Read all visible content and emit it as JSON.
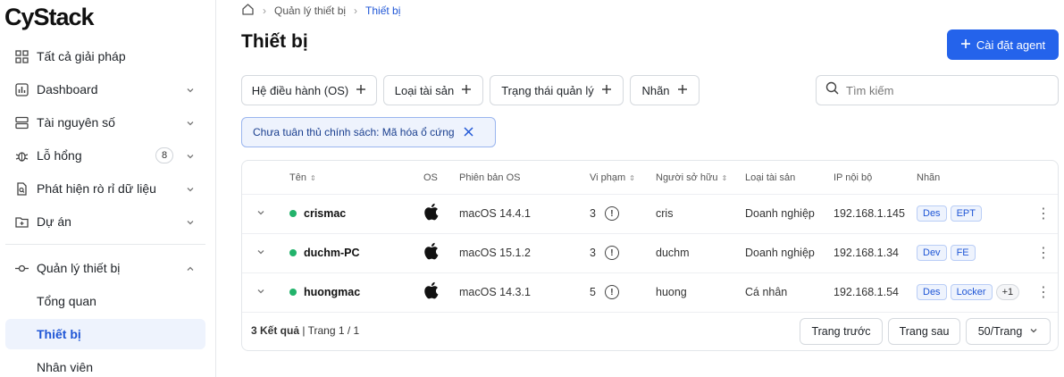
{
  "brand": {
    "logo_text": "CyStack"
  },
  "sidebar": {
    "items": [
      {
        "label": "Tất cả giải pháp",
        "icon": "grid-icon"
      },
      {
        "label": "Dashboard",
        "icon": "chart-icon"
      },
      {
        "label": "Tài nguyên số",
        "icon": "server-icon"
      },
      {
        "label": "Lỗ hổng",
        "icon": "bug-icon",
        "badge": "8"
      },
      {
        "label": "Phát hiện rò rỉ dữ liệu",
        "icon": "document-search-icon"
      },
      {
        "label": "Dự án",
        "icon": "folder-icon"
      },
      {
        "label": "Quản lý thiết bị",
        "icon": "device-icon"
      }
    ],
    "subitems": [
      {
        "label": "Tổng quan"
      },
      {
        "label": "Thiết bị",
        "active": true
      },
      {
        "label": "Nhân viên"
      }
    ]
  },
  "breadcrumb": {
    "home_icon": "home-icon",
    "parent": "Quản lý thiết bị",
    "current": "Thiết bị"
  },
  "header": {
    "title": "Thiết bị",
    "primary_button": "Cài đặt agent"
  },
  "filters": [
    "Hệ điều hành (OS)",
    "Loại tài sản",
    "Trạng thái quản lý",
    "Nhãn"
  ],
  "search": {
    "placeholder": "Tìm kiếm"
  },
  "active_filter_chip": "Chưa tuân thủ chính sách: Mã hóa ổ cứng",
  "table": {
    "columns": [
      "Tên",
      "OS",
      "Phiên bản OS",
      "Vi phạm",
      "Người sở hữu",
      "Loại tài sản",
      "IP nội bộ",
      "Nhãn"
    ],
    "rows": [
      {
        "name": "crismac",
        "os_icon": "apple-icon",
        "os_version": "macOS 14.4.1",
        "violations": "3",
        "owner": "cris",
        "asset_type": "Doanh nghiệp",
        "ip": "192.168.1.145",
        "tags": [
          "Des",
          "EPT"
        ],
        "more": ""
      },
      {
        "name": "duchm-PC",
        "os_icon": "apple-icon",
        "os_version": "macOS 15.1.2",
        "violations": "3",
        "owner": "duchm",
        "asset_type": "Doanh nghiệp",
        "ip": "192.168.1.34",
        "tags": [
          "Dev",
          "FE"
        ],
        "more": ""
      },
      {
        "name": "huongmac",
        "os_icon": "apple-icon",
        "os_version": "macOS 14.3.1",
        "violations": "5",
        "owner": "huong",
        "asset_type": "Cá nhân",
        "ip": "192.168.1.54",
        "tags": [
          "Des",
          "Locker"
        ],
        "more": "+1"
      }
    ],
    "status_color": "#22b36b"
  },
  "pagination": {
    "results_bold": "3 Kết quả",
    "page_text": " | Trang 1 / 1",
    "prev": "Trang trước",
    "next": "Trang sau",
    "per_page": "50/Trang"
  },
  "colors": {
    "accent": "#2463eb",
    "active_bg": "#eef3fd"
  }
}
